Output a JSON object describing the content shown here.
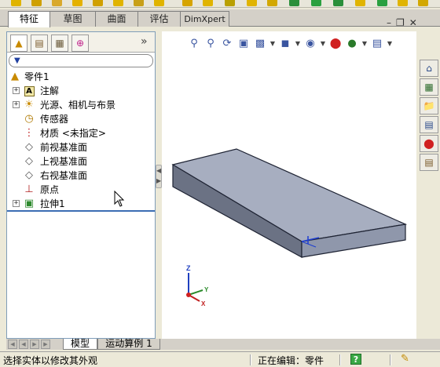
{
  "command_tabs": [
    "特征",
    "草图",
    "曲面",
    "评估",
    "DimXpert"
  ],
  "active_command_tab": "特征",
  "panel_tabs": [
    {
      "icon": "feature-manager-icon"
    },
    {
      "icon": "property-manager-icon"
    },
    {
      "icon": "configuration-manager-icon"
    },
    {
      "icon": "dim-xpert-manager-icon"
    }
  ],
  "panel_collapse": "»",
  "tree": {
    "root": "零件1",
    "items": [
      {
        "label": "注解",
        "icon": "annotations-icon",
        "expandable": true
      },
      {
        "label": "光源、相机与布景",
        "icon": "lights-cameras-icon",
        "expandable": true
      },
      {
        "label": "传感器",
        "icon": "sensors-icon",
        "expandable": false
      },
      {
        "label": "材质 <未指定>",
        "icon": "material-icon",
        "expandable": false
      },
      {
        "label": "前视基准面",
        "icon": "plane-icon",
        "expandable": false
      },
      {
        "label": "上视基准面",
        "icon": "plane-icon",
        "expandable": false
      },
      {
        "label": "右视基准面",
        "icon": "plane-icon",
        "expandable": false
      },
      {
        "label": "原点",
        "icon": "origin-icon",
        "expandable": false
      },
      {
        "label": "拉伸1",
        "icon": "extrude-icon",
        "expandable": true
      }
    ]
  },
  "bottom_tabs": [
    "模型",
    "运动算例 1"
  ],
  "status": {
    "message": "选择实体以修改其外观",
    "editing": "正在编辑：零件",
    "help": "?"
  },
  "triad": {
    "x": "X",
    "y": "Y",
    "z": "Z"
  },
  "colors": {
    "accent": "#3b6db3",
    "part_top": "#a7aec0",
    "part_side": "#6b7284",
    "part_front": "#8f97ab"
  }
}
